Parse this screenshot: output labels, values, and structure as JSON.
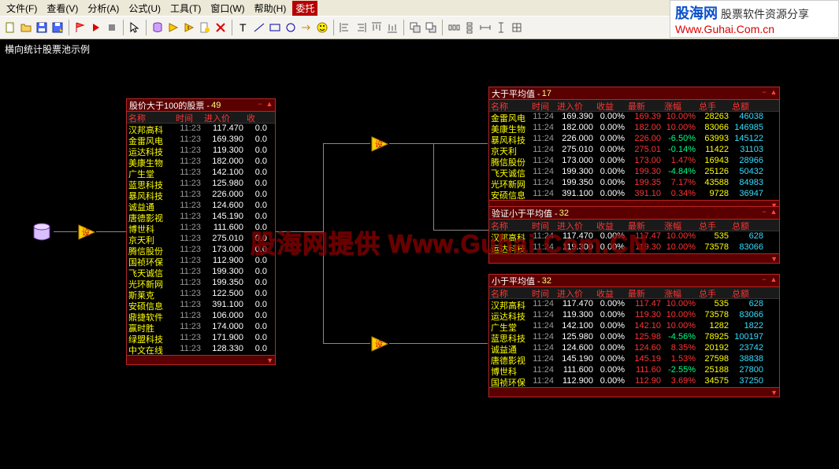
{
  "menu": [
    "文件(F)",
    "查看(V)",
    "分析(A)",
    "公式(U)",
    "工具(T)",
    "窗口(W)",
    "帮助(H)",
    "委托"
  ],
  "canvas_title": "横向统计股票池示例",
  "brand": {
    "name": "股海网",
    "sub": "股票软件资源分享",
    "url": "Www.Guhai.Com.cn"
  },
  "watermark": "股海网提供  Www.Guhai.Com.CN",
  "panels": {
    "p1": {
      "title": "股价大于100的股票",
      "count": "49",
      "cols": [
        "名称",
        "时间",
        "进入价",
        "收"
      ],
      "widths": [
        60,
        36,
        54,
        30
      ],
      "rows": [
        [
          "汉邦高科",
          "11:23",
          "117.470",
          "0.0"
        ],
        [
          "金雷风电",
          "11:23",
          "169.390",
          "0.0"
        ],
        [
          "运达科技",
          "11:23",
          "119.300",
          "0.0"
        ],
        [
          "美康生物",
          "11:23",
          "182.000",
          "0.0"
        ],
        [
          "广生堂",
          "11:23",
          "142.100",
          "0.0"
        ],
        [
          "蓝思科技",
          "11:23",
          "125.980",
          "0.0"
        ],
        [
          "暴风科技",
          "11:23",
          "226.000",
          "0.0"
        ],
        [
          "诚益通",
          "11:23",
          "124.600",
          "0.0"
        ],
        [
          "唐德影视",
          "11:23",
          "145.190",
          "0.0"
        ],
        [
          "博世科",
          "11:23",
          "111.600",
          "0.0"
        ],
        [
          "京天利",
          "11:23",
          "275.010",
          "0.0"
        ],
        [
          "腾信股份",
          "11:23",
          "173.000",
          "0.0"
        ],
        [
          "国祯环保",
          "11:23",
          "112.900",
          "0.0"
        ],
        [
          "飞天诚信",
          "11:23",
          "199.300",
          "0.0"
        ],
        [
          "光环新网",
          "11:23",
          "199.350",
          "0.0"
        ],
        [
          "斯莱克",
          "11:23",
          "122.500",
          "0.0"
        ],
        [
          "安硕信息",
          "11:23",
          "391.100",
          "0.0"
        ],
        [
          "鼎捷软件",
          "11:23",
          "106.000",
          "0.0"
        ],
        [
          "赢时胜",
          "11:23",
          "174.000",
          "0.0"
        ],
        [
          "绿盟科技",
          "11:23",
          "171.900",
          "0.0"
        ],
        [
          "中文在线",
          "11:23",
          "128.330",
          "0.0"
        ]
      ]
    },
    "p2": {
      "title": "大于平均值",
      "count": "17",
      "cols": [
        "名称",
        "时间",
        "进入价",
        "收益",
        "最新",
        "涨幅",
        "总手",
        "总额"
      ],
      "widths": [
        52,
        32,
        50,
        40,
        46,
        44,
        42,
        44
      ],
      "rows": [
        [
          "金雷风电",
          "11:24",
          "169.390",
          "0.00%",
          "169.39",
          "10.00%",
          "28263",
          "46038",
          "r",
          "r"
        ],
        [
          "美康生物",
          "11:24",
          "182.000",
          "0.00%",
          "182.00",
          "10.00%",
          "83066",
          "146985",
          "r",
          "r"
        ],
        [
          "暴风科技",
          "11:24",
          "226.000",
          "0.00%",
          "226.00",
          "-6.50%",
          "63993",
          "145122",
          "r",
          "g"
        ],
        [
          "京天利",
          "11:24",
          "275.010",
          "0.00%",
          "275.01",
          "-0.14%",
          "11422",
          "31103",
          "r",
          "g"
        ],
        [
          "腾信股份",
          "11:24",
          "173.000",
          "0.00%",
          "173.00",
          "1.47%",
          "16943",
          "28966",
          "r",
          "r"
        ],
        [
          "飞天诚信",
          "11:24",
          "199.300",
          "0.00%",
          "199.30",
          "-4.84%",
          "25126",
          "50432",
          "r",
          "g"
        ],
        [
          "光环新网",
          "11:24",
          "199.350",
          "0.00%",
          "199.35",
          "7.17%",
          "43588",
          "84983",
          "r",
          "r"
        ],
        [
          "安硕信息",
          "11:24",
          "391.100",
          "0.00%",
          "391.10",
          "0.34%",
          "9728",
          "36947",
          "r",
          "r"
        ]
      ]
    },
    "p3": {
      "title": "验证小于平均值",
      "count": "32",
      "cols": [
        "名称",
        "时间",
        "进入价",
        "收益",
        "最新",
        "涨幅",
        "总手",
        "总额"
      ],
      "widths": [
        52,
        32,
        50,
        40,
        46,
        44,
        42,
        44
      ],
      "rows": [
        [
          "汉邦高科",
          "11:24",
          "117.470",
          "0.00%",
          "117.47",
          "10.00%",
          "535",
          "628",
          "r",
          "r"
        ],
        [
          "运达科技",
          "11:24",
          "119.300",
          "0.00%",
          "119.30",
          "10.00%",
          "73578",
          "83066",
          "r",
          "r"
        ]
      ]
    },
    "p4": {
      "title": "小于平均值",
      "count": "32",
      "cols": [
        "名称",
        "时间",
        "进入价",
        "收益",
        "最新",
        "涨幅",
        "总手",
        "总额"
      ],
      "widths": [
        52,
        32,
        50,
        40,
        46,
        44,
        42,
        44
      ],
      "rows": [
        [
          "汉邦高科",
          "11:24",
          "117.470",
          "0.00%",
          "117.47",
          "10.00%",
          "535",
          "628",
          "r",
          "r"
        ],
        [
          "运达科技",
          "11:24",
          "119.300",
          "0.00%",
          "119.30",
          "10.00%",
          "73578",
          "83066",
          "r",
          "r"
        ],
        [
          "广生堂",
          "11:24",
          "142.100",
          "0.00%",
          "142.10",
          "10.00%",
          "1282",
          "1822",
          "r",
          "r"
        ],
        [
          "蓝思科技",
          "11:24",
          "125.980",
          "0.00%",
          "125.98",
          "-4.56%",
          "78925",
          "100197",
          "r",
          "g"
        ],
        [
          "诚益通",
          "11:24",
          "124.600",
          "0.00%",
          "124.60",
          "8.35%",
          "20192",
          "23742",
          "r",
          "r"
        ],
        [
          "唐德影视",
          "11:24",
          "145.190",
          "0.00%",
          "145.19",
          "1.53%",
          "27598",
          "38838",
          "r",
          "r"
        ],
        [
          "博世科",
          "11:24",
          "111.600",
          "0.00%",
          "111.60",
          "-2.55%",
          "25188",
          "27800",
          "r",
          "g"
        ],
        [
          "国祯环保",
          "11:24",
          "112.900",
          "0.00%",
          "112.90",
          "3.69%",
          "34575",
          "37250",
          "r",
          "r"
        ]
      ]
    }
  }
}
